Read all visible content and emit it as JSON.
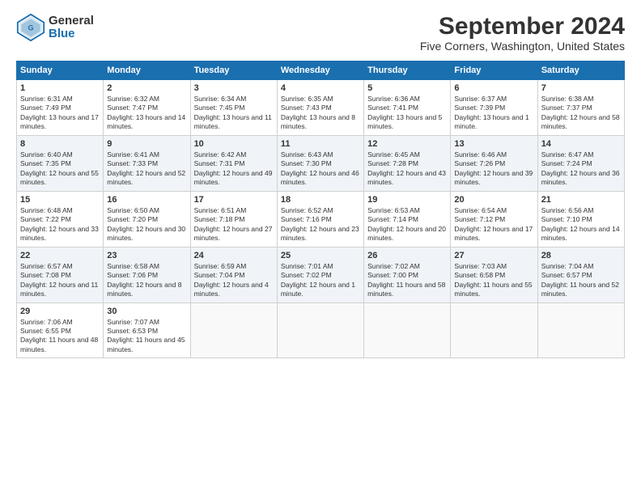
{
  "logo": {
    "general": "General",
    "blue": "Blue"
  },
  "title": "September 2024",
  "subtitle": "Five Corners, Washington, United States",
  "weekdays": [
    "Sunday",
    "Monday",
    "Tuesday",
    "Wednesday",
    "Thursday",
    "Friday",
    "Saturday"
  ],
  "weeks": [
    [
      {
        "day": "1",
        "sunrise": "Sunrise: 6:31 AM",
        "sunset": "Sunset: 7:49 PM",
        "daylight": "Daylight: 13 hours and 17 minutes."
      },
      {
        "day": "2",
        "sunrise": "Sunrise: 6:32 AM",
        "sunset": "Sunset: 7:47 PM",
        "daylight": "Daylight: 13 hours and 14 minutes."
      },
      {
        "day": "3",
        "sunrise": "Sunrise: 6:34 AM",
        "sunset": "Sunset: 7:45 PM",
        "daylight": "Daylight: 13 hours and 11 minutes."
      },
      {
        "day": "4",
        "sunrise": "Sunrise: 6:35 AM",
        "sunset": "Sunset: 7:43 PM",
        "daylight": "Daylight: 13 hours and 8 minutes."
      },
      {
        "day": "5",
        "sunrise": "Sunrise: 6:36 AM",
        "sunset": "Sunset: 7:41 PM",
        "daylight": "Daylight: 13 hours and 5 minutes."
      },
      {
        "day": "6",
        "sunrise": "Sunrise: 6:37 AM",
        "sunset": "Sunset: 7:39 PM",
        "daylight": "Daylight: 13 hours and 1 minute."
      },
      {
        "day": "7",
        "sunrise": "Sunrise: 6:38 AM",
        "sunset": "Sunset: 7:37 PM",
        "daylight": "Daylight: 12 hours and 58 minutes."
      }
    ],
    [
      {
        "day": "8",
        "sunrise": "Sunrise: 6:40 AM",
        "sunset": "Sunset: 7:35 PM",
        "daylight": "Daylight: 12 hours and 55 minutes."
      },
      {
        "day": "9",
        "sunrise": "Sunrise: 6:41 AM",
        "sunset": "Sunset: 7:33 PM",
        "daylight": "Daylight: 12 hours and 52 minutes."
      },
      {
        "day": "10",
        "sunrise": "Sunrise: 6:42 AM",
        "sunset": "Sunset: 7:31 PM",
        "daylight": "Daylight: 12 hours and 49 minutes."
      },
      {
        "day": "11",
        "sunrise": "Sunrise: 6:43 AM",
        "sunset": "Sunset: 7:30 PM",
        "daylight": "Daylight: 12 hours and 46 minutes."
      },
      {
        "day": "12",
        "sunrise": "Sunrise: 6:45 AM",
        "sunset": "Sunset: 7:28 PM",
        "daylight": "Daylight: 12 hours and 43 minutes."
      },
      {
        "day": "13",
        "sunrise": "Sunrise: 6:46 AM",
        "sunset": "Sunset: 7:26 PM",
        "daylight": "Daylight: 12 hours and 39 minutes."
      },
      {
        "day": "14",
        "sunrise": "Sunrise: 6:47 AM",
        "sunset": "Sunset: 7:24 PM",
        "daylight": "Daylight: 12 hours and 36 minutes."
      }
    ],
    [
      {
        "day": "15",
        "sunrise": "Sunrise: 6:48 AM",
        "sunset": "Sunset: 7:22 PM",
        "daylight": "Daylight: 12 hours and 33 minutes."
      },
      {
        "day": "16",
        "sunrise": "Sunrise: 6:50 AM",
        "sunset": "Sunset: 7:20 PM",
        "daylight": "Daylight: 12 hours and 30 minutes."
      },
      {
        "day": "17",
        "sunrise": "Sunrise: 6:51 AM",
        "sunset": "Sunset: 7:18 PM",
        "daylight": "Daylight: 12 hours and 27 minutes."
      },
      {
        "day": "18",
        "sunrise": "Sunrise: 6:52 AM",
        "sunset": "Sunset: 7:16 PM",
        "daylight": "Daylight: 12 hours and 23 minutes."
      },
      {
        "day": "19",
        "sunrise": "Sunrise: 6:53 AM",
        "sunset": "Sunset: 7:14 PM",
        "daylight": "Daylight: 12 hours and 20 minutes."
      },
      {
        "day": "20",
        "sunrise": "Sunrise: 6:54 AM",
        "sunset": "Sunset: 7:12 PM",
        "daylight": "Daylight: 12 hours and 17 minutes."
      },
      {
        "day": "21",
        "sunrise": "Sunrise: 6:56 AM",
        "sunset": "Sunset: 7:10 PM",
        "daylight": "Daylight: 12 hours and 14 minutes."
      }
    ],
    [
      {
        "day": "22",
        "sunrise": "Sunrise: 6:57 AM",
        "sunset": "Sunset: 7:08 PM",
        "daylight": "Daylight: 12 hours and 11 minutes."
      },
      {
        "day": "23",
        "sunrise": "Sunrise: 6:58 AM",
        "sunset": "Sunset: 7:06 PM",
        "daylight": "Daylight: 12 hours and 8 minutes."
      },
      {
        "day": "24",
        "sunrise": "Sunrise: 6:59 AM",
        "sunset": "Sunset: 7:04 PM",
        "daylight": "Daylight: 12 hours and 4 minutes."
      },
      {
        "day": "25",
        "sunrise": "Sunrise: 7:01 AM",
        "sunset": "Sunset: 7:02 PM",
        "daylight": "Daylight: 12 hours and 1 minute."
      },
      {
        "day": "26",
        "sunrise": "Sunrise: 7:02 AM",
        "sunset": "Sunset: 7:00 PM",
        "daylight": "Daylight: 11 hours and 58 minutes."
      },
      {
        "day": "27",
        "sunrise": "Sunrise: 7:03 AM",
        "sunset": "Sunset: 6:58 PM",
        "daylight": "Daylight: 11 hours and 55 minutes."
      },
      {
        "day": "28",
        "sunrise": "Sunrise: 7:04 AM",
        "sunset": "Sunset: 6:57 PM",
        "daylight": "Daylight: 11 hours and 52 minutes."
      }
    ],
    [
      {
        "day": "29",
        "sunrise": "Sunrise: 7:06 AM",
        "sunset": "Sunset: 6:55 PM",
        "daylight": "Daylight: 11 hours and 48 minutes."
      },
      {
        "day": "30",
        "sunrise": "Sunrise: 7:07 AM",
        "sunset": "Sunset: 6:53 PM",
        "daylight": "Daylight: 11 hours and 45 minutes."
      },
      null,
      null,
      null,
      null,
      null
    ]
  ]
}
